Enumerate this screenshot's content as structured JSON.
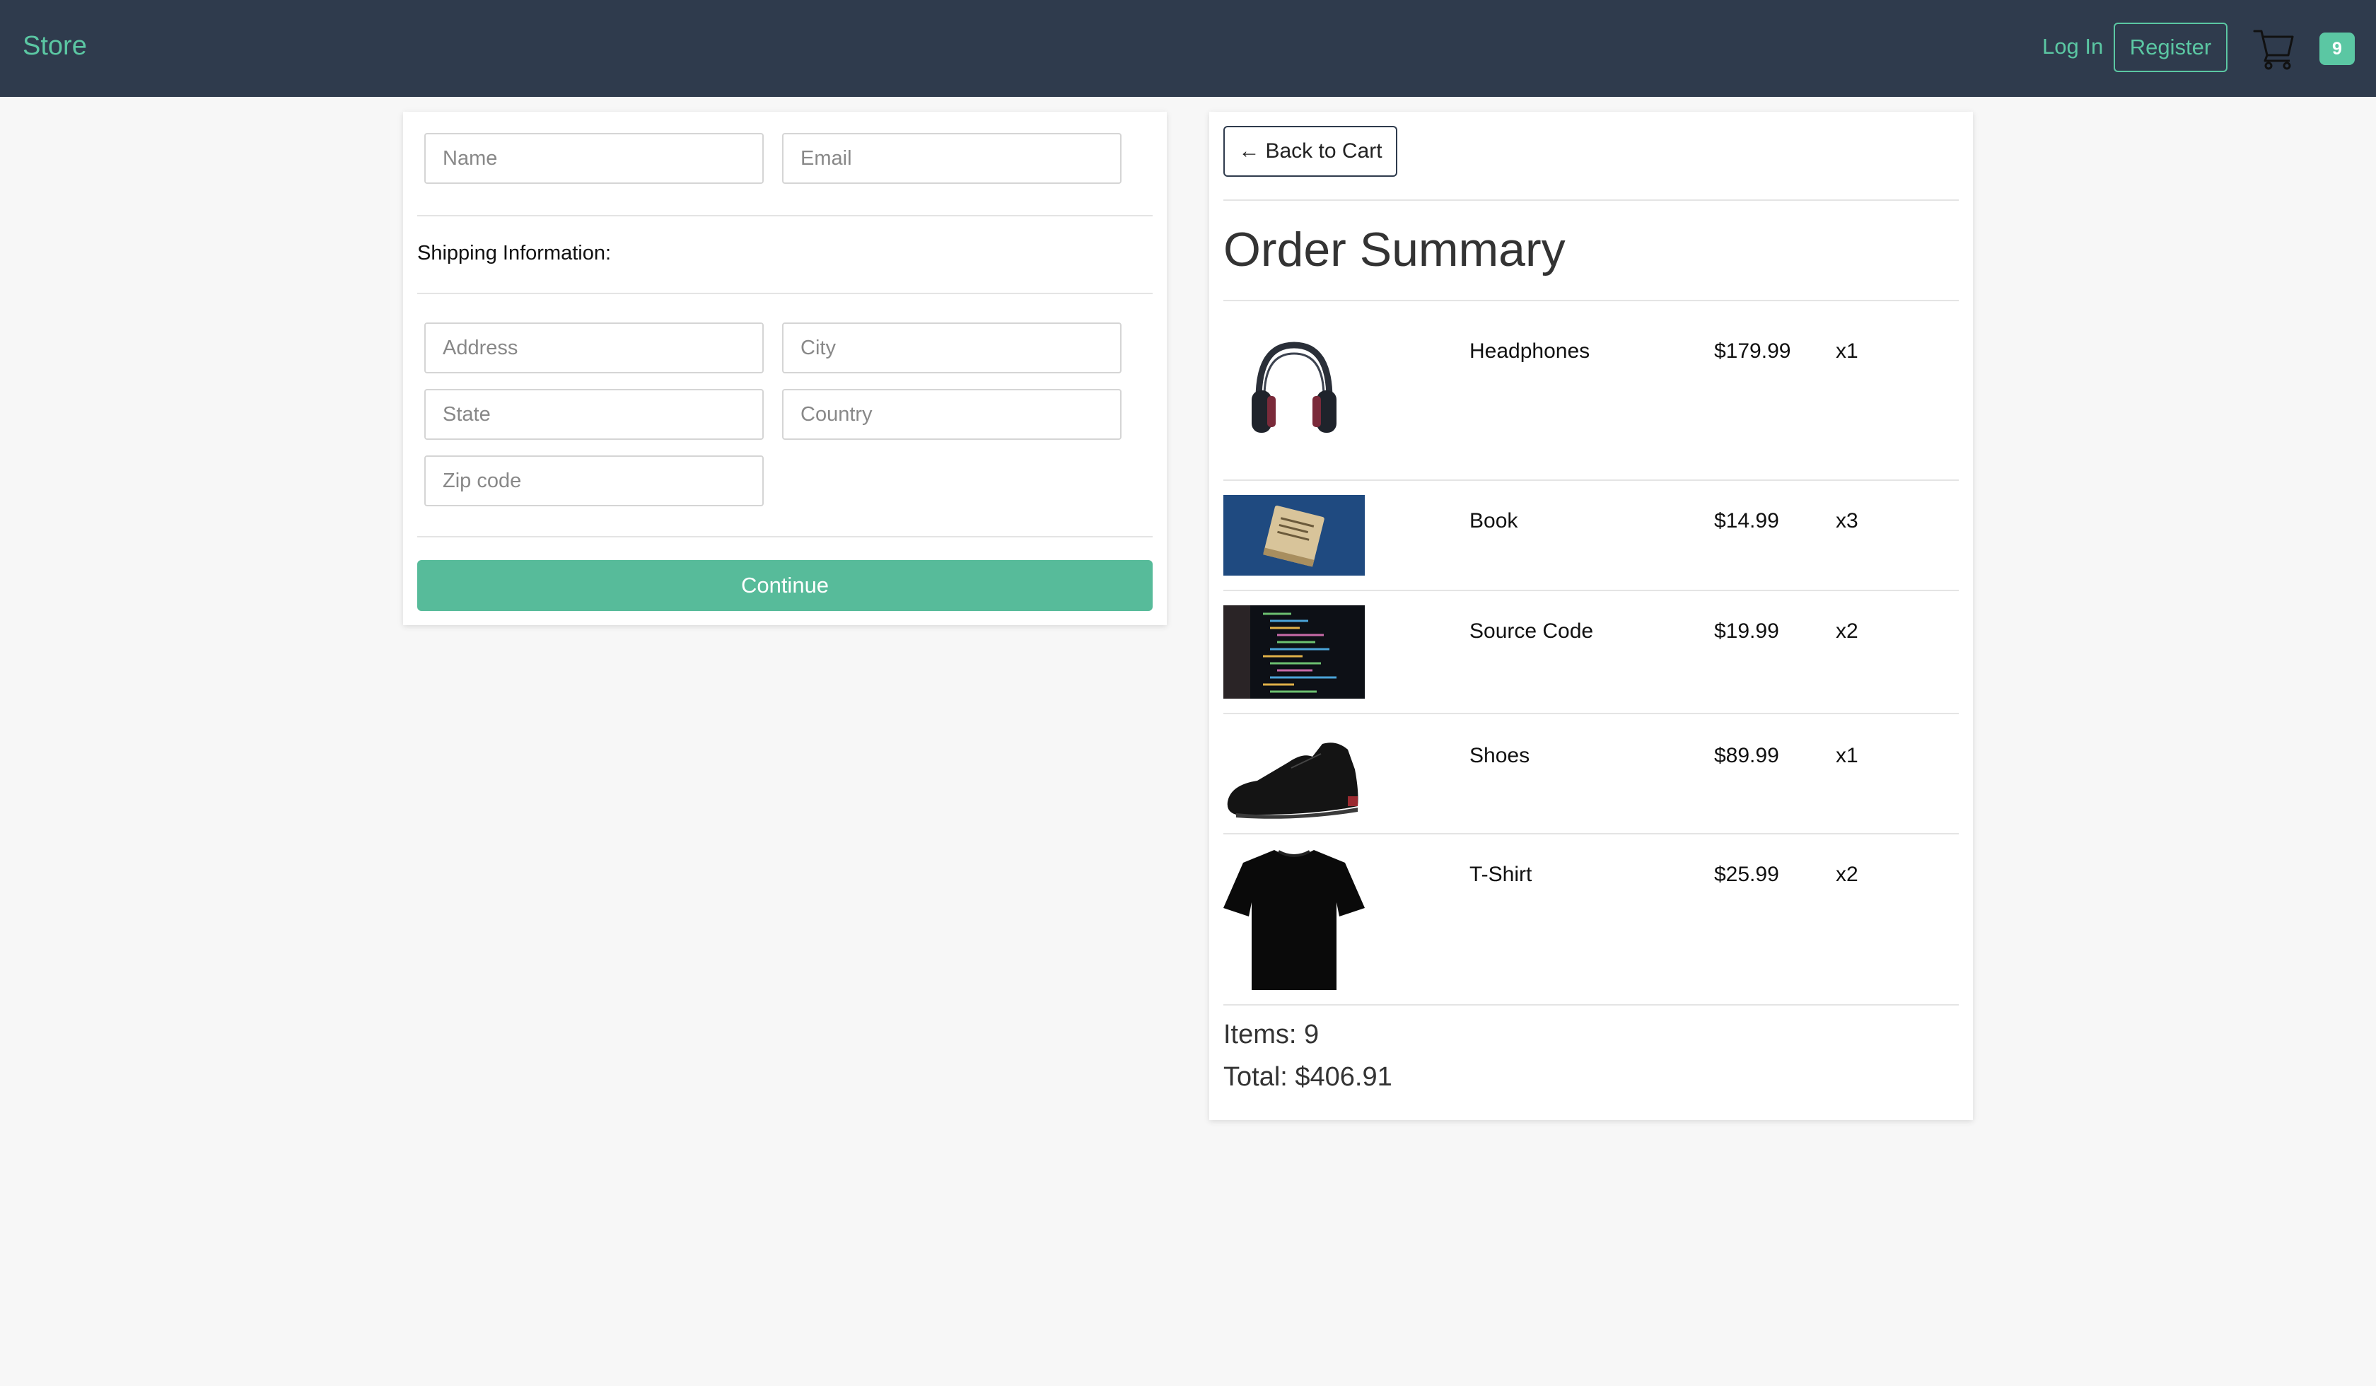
{
  "navbar": {
    "brand": "Store",
    "login": "Log In",
    "register": "Register",
    "cart_icon": "cart-icon",
    "cart_count": "9",
    "bg_color": "#2f3b4d",
    "accent_color": "#5bc7a3"
  },
  "form": {
    "name_placeholder": "Name",
    "email_placeholder": "Email",
    "shipping_label": "Shipping Information:",
    "address_placeholder": "Address",
    "city_placeholder": "City",
    "state_placeholder": "State",
    "country_placeholder": "Country",
    "zip_placeholder": "Zip code",
    "continue": "Continue"
  },
  "summary": {
    "back_arrow": "←",
    "back": "Back to Cart",
    "title": "Order Summary",
    "items": [
      {
        "name": "Headphones",
        "price": "$179.99",
        "qty": "x1",
        "icon": "headphones-image"
      },
      {
        "name": "Book",
        "price": "$14.99",
        "qty": "x3",
        "icon": "book-image"
      },
      {
        "name": "Source Code",
        "price": "$19.99",
        "qty": "x2",
        "icon": "source-code-image"
      },
      {
        "name": "Shoes",
        "price": "$89.99",
        "qty": "x1",
        "icon": "shoes-image"
      },
      {
        "name": "T-Shirt",
        "price": "$25.99",
        "qty": "x2",
        "icon": "tshirt-image"
      }
    ],
    "items_count": "Items: 9",
    "total": "Total: $406.91"
  }
}
